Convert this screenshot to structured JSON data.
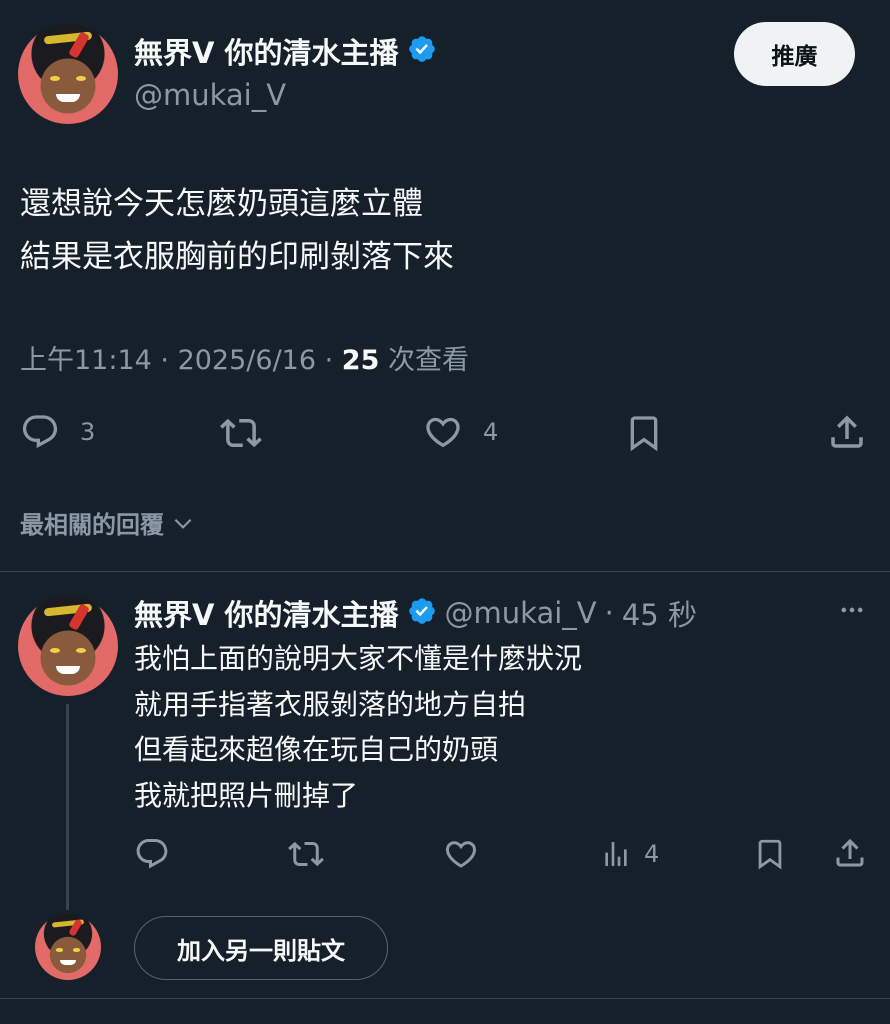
{
  "tweet": {
    "author_name": "無界V 你的清水主播",
    "author_handle": "@mukai_V",
    "promote_label": "推廣",
    "text_lines": [
      "還想說今天怎麼奶頭這麼立體",
      "結果是衣服胸前的印刷剝落下來"
    ],
    "time": "上午11:14",
    "date": "2025/6/16",
    "views_count": "25",
    "views_label": "次查看",
    "replies": "3",
    "likes": "4"
  },
  "replies_sort": {
    "label": "最相關的回覆"
  },
  "reply": {
    "author_name": "無界V 你的清水主播",
    "author_handle": "@mukai_V",
    "age": "45 秒",
    "text_lines": [
      "我怕上面的說明大家不懂是什麼狀況",
      "就用手指著衣服剝落的地方自拍",
      "但看起來超像在玩自己的奶頭",
      "我就把照片刪掉了"
    ],
    "views": "4"
  },
  "compose": {
    "add_post_label": "加入另一則貼文"
  },
  "colors": {
    "background": "#15202b",
    "verified": "#1d9bf0",
    "muted": "#8b98a5"
  }
}
